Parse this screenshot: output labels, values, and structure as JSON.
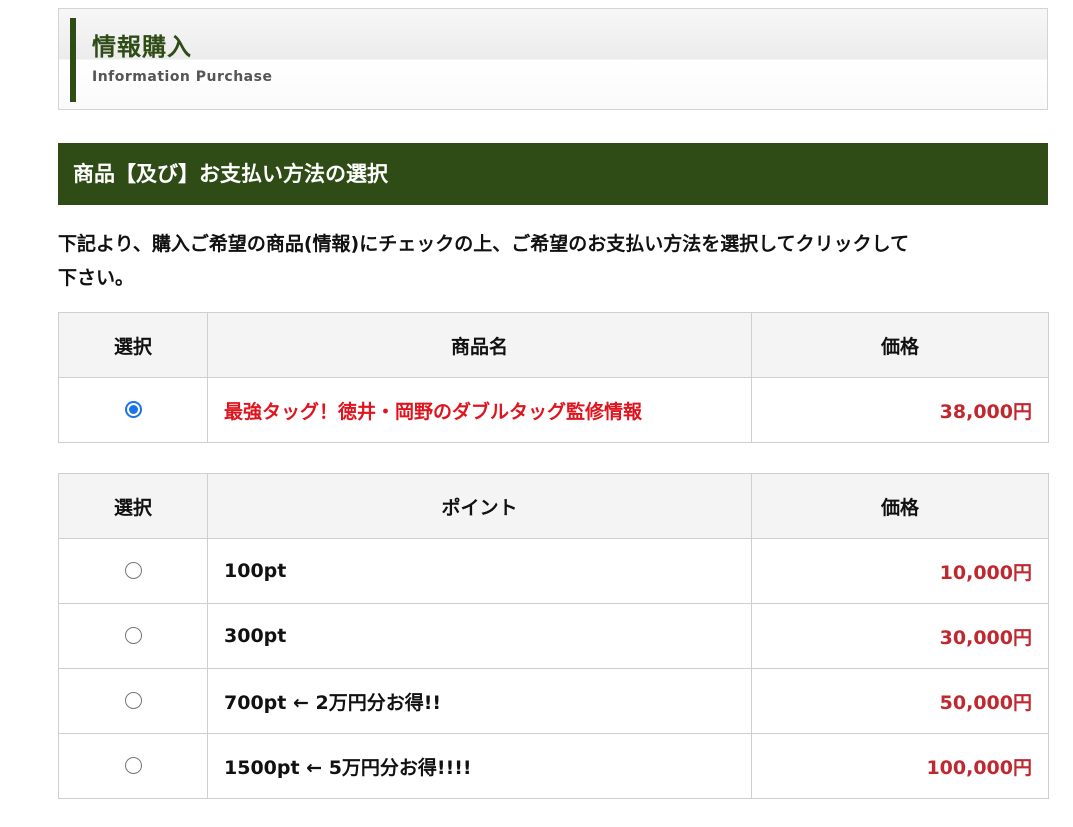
{
  "header": {
    "title": "情報購入",
    "subtitle": "Information Purchase",
    "accent_color": "#2f4c17"
  },
  "section": {
    "title": "商品【及び】お支払い方法の選択"
  },
  "instruction": {
    "line1": "下記より、購入ご希望の商品(情報)にチェックの上、ご希望のお支払い方法を選択してクリックして",
    "line2": "下さい。"
  },
  "product_table": {
    "headers": [
      "選択",
      "商品名",
      "価格"
    ],
    "rows": [
      {
        "name": "最強タッグ！徳井・岡野のダブルタッグ監修情報",
        "price": "38,000円",
        "selected": true
      }
    ]
  },
  "point_table": {
    "headers": [
      "選択",
      "ポイント",
      "価格"
    ],
    "rows": [
      {
        "name": "100pt",
        "price": "10,000円",
        "selected": false
      },
      {
        "name": "300pt",
        "price": "30,000円",
        "selected": false
      },
      {
        "name": "700pt ← 2万円分お得!!",
        "price": "50,000円",
        "selected": false
      },
      {
        "name": "1500pt ← 5万円分お得!!!!",
        "price": "100,000円",
        "selected": false
      }
    ]
  },
  "colors": {
    "price": "#c0282f",
    "product_name": "#e0141e",
    "section_bar": "#2f4c17",
    "radio_checked": "#1a73e8"
  }
}
